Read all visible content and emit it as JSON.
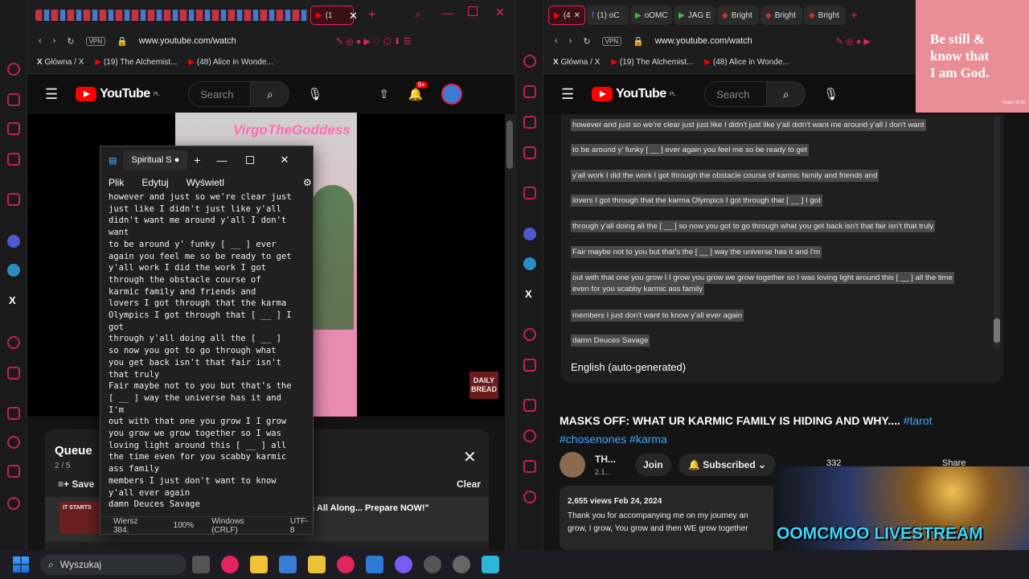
{
  "left": {
    "bookmarks": [
      "Główna / X",
      "(19) The Alchemist...",
      "(48) Alice in Wonde..."
    ],
    "url": "www.youtube.com/watch",
    "search_placeholder": "Search",
    "brand": "YouTube",
    "region": "PL",
    "notif_count": "9+",
    "video_overlay": "VirgoTheGoddess",
    "daily_bread": "DAILY BREAD",
    "queue": {
      "title": "Queue",
      "count": "2 / 5",
      "save": "Save",
      "clear": "Clear",
      "item_title": "Plan All Along... Prepare NOW!\"",
      "thumb_text": "IT STARTS"
    }
  },
  "notepad": {
    "title": "Spiritual S",
    "menu": [
      "Plik",
      "Edytuj",
      "Wyświetl"
    ],
    "text": "however and just so we're clear just\njust like I didn't just like y'all\ndidn't want me around y'all I don't\nwant\nto be around y' funky [ __ ] ever\nagain you feel me so be ready to get\ny'all work I did the work I got\nthrough the obstacle course of\nkarmic family and friends and\nlovers I got through that the karma\nOlympics I got through that [ __ ] I\ngot\nthrough y'all doing all the [ __ ]\nso now you got to go through what\nyou get back isn't that fair isn't\nthat truly\nFair maybe not to you but that's the\n[ __ ] way the universe has it and\nI'm\nout with that one you grow I I grow\nyou grow we grow together so I was\nloving light around this [ __ ] all\nthe time even for you scabby karmic\nass family\nmembers I just don't want to know\ny'all ever again\ndamn Deuces Savage",
    "status": [
      "Wiersz 384,",
      "100%",
      "Windows (CRLF)",
      "UTF-8"
    ]
  },
  "right": {
    "bookmarks": [
      "Główna / X",
      "(19) The Alchemist...",
      "(48) Alice in Wonde..."
    ],
    "url": "www.youtube.com/watch",
    "search_placeholder": "Search",
    "brand": "YouTube",
    "region": "PL",
    "tabs": [
      "(4",
      "(1) oC",
      "oOMC",
      "JAG E",
      "Bright",
      "Bright",
      "Bright"
    ],
    "transcript": [
      "however and just so we're clear just just like I didn't just like y'all didn't want me around y'all I don't want",
      "to be around y' funky [ __ ] ever again you feel me so be ready to get",
      "y'all work I did the work I got through the obstacle course of karmic family and friends and",
      "lovers I got through that the karma Olympics I got through that [ __ ] I got",
      "through y'all doing all the [ __ ] so now you got to go through what you get back isn't that fair isn't that truly",
      "Fair maybe not to you but that's the [ __ ] way the universe has it and I'm",
      "out with that one you grow I I grow you grow we grow together so I was loving light around this [ __ ] all the time",
      "even for you scabby karmic ass family",
      "members I just don't want to know y'all ever again",
      "damn Deuces Savage"
    ],
    "language": "English (auto-generated)",
    "video_title": "MASKS OFF: WHAT UR KARMIC FAMILY IS HIDING AND WHY....",
    "tags1": "#tarot",
    "tags2": "#chosenones #karma",
    "channel": "TH...",
    "subs": "2.1...",
    "join": "Join",
    "subscribed": "Subscribed",
    "likes": "332",
    "share": "Share",
    "views": "2,655 views  Feb 24, 2024",
    "desc1": "Thank you for accompanying me on my journey an",
    "desc2": "grow, I grow, You grow and then WE grow together"
  },
  "quote": {
    "l1": "Be still &",
    "l2": "know that",
    "l3": "I am God.",
    "small": "Psalm 46:10"
  },
  "livestream": "OOMCMOO LIVESTREAM",
  "taskbar": {
    "search": "Wyszukaj"
  }
}
